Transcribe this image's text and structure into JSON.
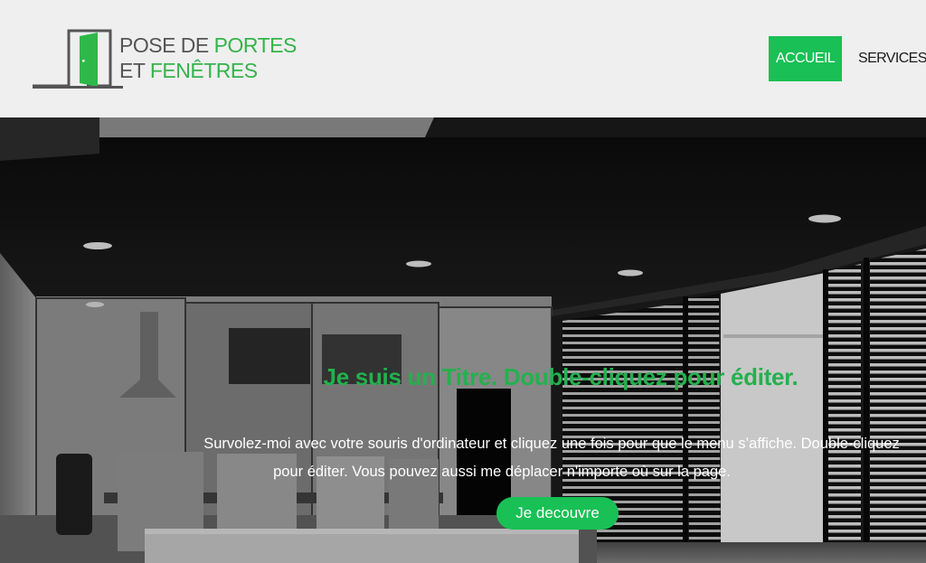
{
  "logo": {
    "line1_part1": "POSE DE ",
    "line1_part2": "PORTES",
    "line2_part1": "ET ",
    "line2_part2": "FENÊTRES",
    "icon": "door-icon"
  },
  "nav": {
    "items": [
      {
        "label": "ACCUEIL",
        "active": true
      },
      {
        "label": "SERVICES",
        "active": false
      }
    ]
  },
  "hero": {
    "title": "Je suis un Titre. Double-cliquez pour éditer.",
    "text_line1": "Survolez-moi avec votre souris d'ordinateur et cliquez une fois pour que le menu s’affiche. Double-cliquez",
    "text_line2": "pour éditer. Vous pouvez aussi me déplacer n'importe où sur la page.",
    "button_label": "Je decouvre"
  },
  "colors": {
    "accent": "#19c055",
    "title_green": "#23b14d",
    "logo_grey": "#555555",
    "header_bg": "#efefef"
  }
}
